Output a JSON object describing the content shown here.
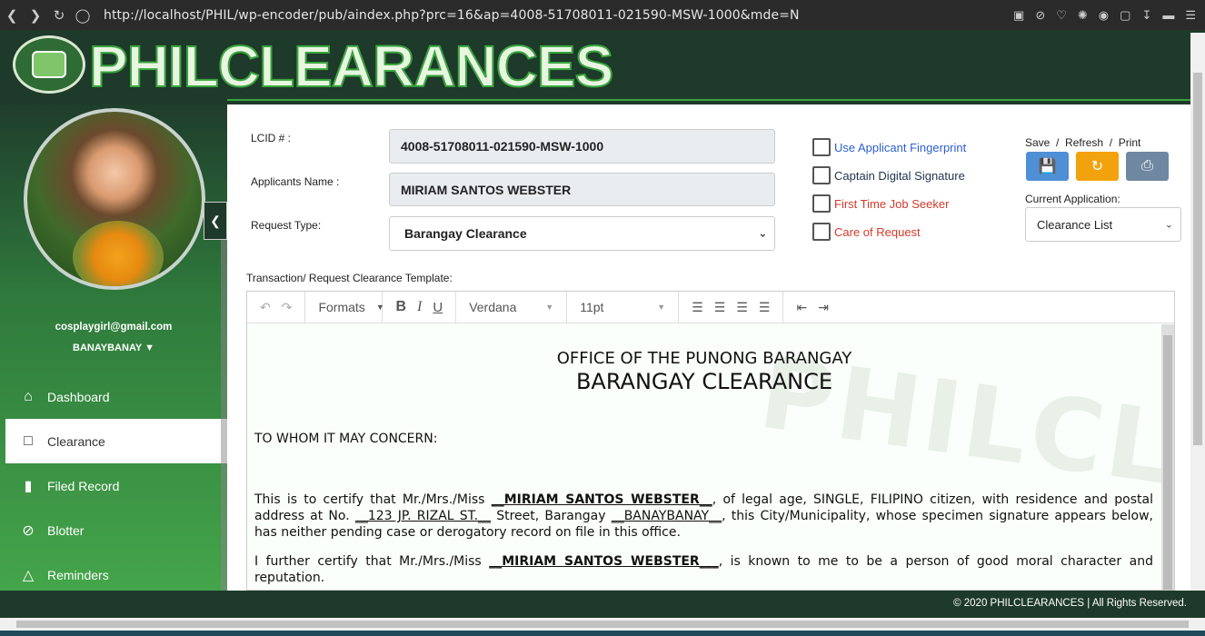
{
  "browser": {
    "url": "http://localhost/PHIL/wp-encoder/pub/aindex.php?prc=16&ap=4008-51708011-021590-MSW-1000&mde=N"
  },
  "header": {
    "brand": "PHILCLEARANCES"
  },
  "sidebar": {
    "email": "cosplaygirl@gmail.com",
    "barangay": "BANAYBANAY",
    "items": [
      {
        "label": "Dashboard",
        "icon": "home-icon"
      },
      {
        "label": "Clearance",
        "icon": "document-icon"
      },
      {
        "label": "Filed Record",
        "icon": "book-icon"
      },
      {
        "label": "Blotter",
        "icon": "ban-icon"
      },
      {
        "label": "Reminders",
        "icon": "warning-icon"
      }
    ]
  },
  "form": {
    "lcid_label": "LCID # :",
    "lcid_value": "4008-51708011-021590-MSW-1000",
    "name_label": "Applicants Name :",
    "name_value": "MIRIAM SANTOS WEBSTER",
    "request_label": "Request Type:",
    "request_value": "Barangay Clearance",
    "template_label": "Transaction/ Request Clearance Template:"
  },
  "options": {
    "fingerprint": "Use Applicant Fingerprint",
    "signature": "Captain Digital Signature",
    "job_seeker": "First Time Job Seeker",
    "care_of": "Care of Request"
  },
  "actions": {
    "label": "Save  /  Refresh  /  Print",
    "current_label": "Current Application:",
    "current_value": "Clearance List"
  },
  "editor": {
    "formats": "Formats",
    "font": "Verdana",
    "size": "11pt",
    "watermark": "PHILCLEARANCES",
    "heading1": "OFFICE OF THE PUNONG BARANGAY",
    "heading2": "BARANGAY CLEARANCE",
    "salutation": "TO WHOM IT MAY CONCERN:",
    "p1_a": "This is to certify that Mr./Mrs./Miss ",
    "p1_name": "__MIRIAM SANTOS WEBSTER__",
    "p1_b": ", of legal age, SINGLE, FILIPINO citizen, with residence and postal address at No. ",
    "p1_addr": "__123 JP. RIZAL ST.__",
    "p1_c": " Street, Barangay ",
    "p1_brgy": "__BANAYBANAY__",
    "p1_d": ", this City/Municipality, whose specimen signature appears below, has neither pending case or derogatory record on file in this office.",
    "p2_a": "I further certify that Mr./Mrs./Miss ",
    "p2_name": "__MIRIAM SANTOS WEBSTER___",
    "p2_b": ", is known to me to be a person of good moral character and reputation."
  },
  "footer": {
    "copyright": "© 2020 PHILCLEARANCES | All Rights Reserved."
  }
}
